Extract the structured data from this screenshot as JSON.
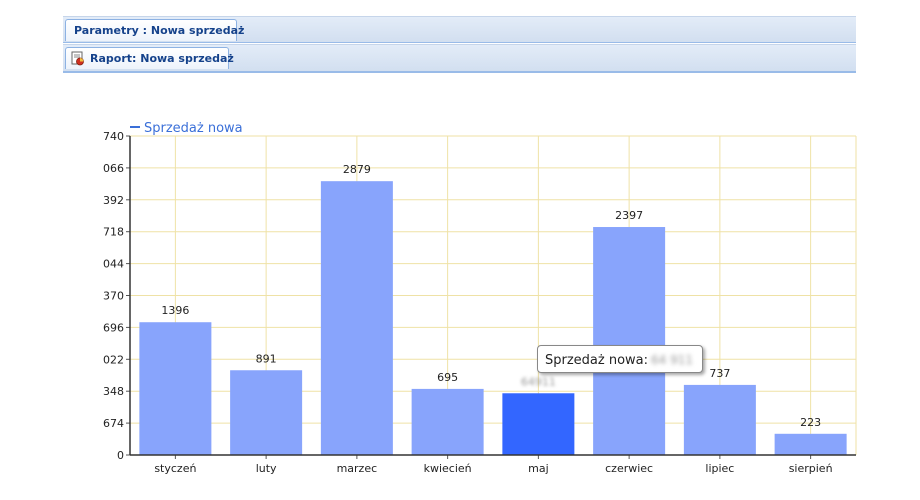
{
  "tabs": {
    "params_label": "Parametry : Nowa sprzedaż",
    "report_label": "Raport: Nowa sprzedaż"
  },
  "tooltip": {
    "label": "Sprzedaż nowa:",
    "value_redacted": "64 911"
  },
  "chart_data": {
    "type": "bar",
    "legend_position": "top-left",
    "grid": true,
    "ylim": [
      0,
      3354
    ],
    "y_tick_labels": [
      "0",
      "674",
      "348",
      "022",
      "696",
      "370",
      "044",
      "718",
      "392",
      "066",
      "740"
    ],
    "categories": [
      "styczeń",
      "luty",
      "marzec",
      "kwiecień",
      "maj",
      "czerwiec",
      "lipiec",
      "sierpień"
    ],
    "series": [
      {
        "name": "Sprzedaż nowa",
        "values": [
          1396,
          891,
          2879,
          695,
          649,
          2397,
          737,
          223
        ],
        "data_labels": [
          "1396",
          "891",
          "2879",
          "695",
          "64911",
          "2397",
          "737",
          "223"
        ],
        "color": "#88a4fc",
        "highlight_index": 4,
        "highlight_color": "#3366ff"
      }
    ]
  }
}
